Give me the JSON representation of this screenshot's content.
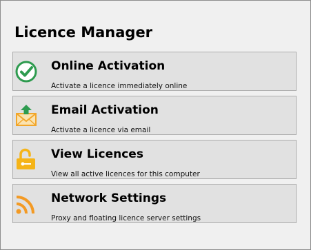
{
  "header": {
    "title": "Licence Manager"
  },
  "options": [
    {
      "title": "Online Activation",
      "description": "Activate a licence immediately online",
      "icon": "check-circle-icon",
      "color": "#2e9b4f"
    },
    {
      "title": "Email Activation",
      "description": "Activate a licence via email",
      "icon": "email-upload-icon",
      "color": "#f2a62a"
    },
    {
      "title": "View Licences",
      "description": "View all active licences for this computer",
      "icon": "padlock-open-icon",
      "color": "#f5b418"
    },
    {
      "title": "Network Settings",
      "description": "Proxy and floating licence server settings",
      "icon": "wifi-signal-icon",
      "color": "#f39a24"
    }
  ]
}
